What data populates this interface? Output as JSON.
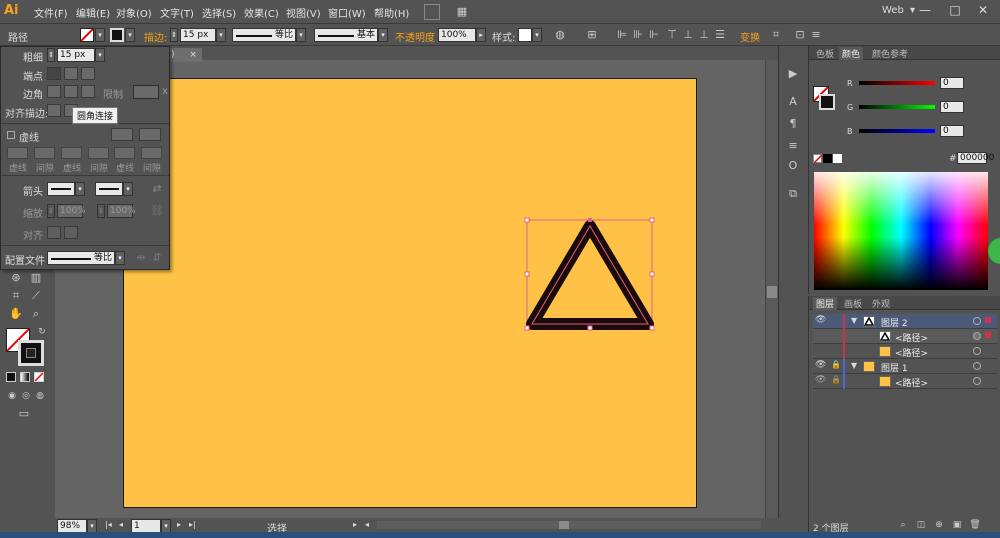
{
  "app": {
    "logo": "Ai",
    "workspace": "Web",
    "win_min": "—",
    "win_max": "□",
    "win_close": "✕"
  },
  "menu": [
    "文件(F)",
    "编辑(E)",
    "对象(O)",
    "文字(T)",
    "选择(S)",
    "效果(C)",
    "视图(V)",
    "窗口(W)",
    "帮助(H)"
  ],
  "control": {
    "object_type": "路径",
    "stroke_label": "描边:",
    "stroke_weight": "15 px",
    "variable_width": "等比",
    "brush": "基本",
    "opacity_label": "不透明度",
    "opacity_value": "100%",
    "style_label": "样式:",
    "transform_label": "变换"
  },
  "doc_tab": {
    "label": "览)",
    "close": "×"
  },
  "stroke_panel": {
    "weight_label": "粗细",
    "weight_value": "15 px",
    "cap_label": "端点",
    "corner_label": "边角",
    "limit_label": "限制",
    "align_label": "对齐描边:",
    "tooltip": "圆角连接",
    "dashed_label": "虚线",
    "dash_labels": [
      "虚线",
      "间隙",
      "虚线",
      "间隙",
      "虚线",
      "间隙"
    ],
    "arrow_label": "箭头",
    "scale_label": "缩放",
    "scale_values": [
      "100%",
      "100%"
    ],
    "align_label2": "对齐",
    "profile_label": "配置文件",
    "profile_value": "等比"
  },
  "color_panel": {
    "tabs": [
      "色板",
      "颜色",
      "颜色参考"
    ],
    "active_tab": "颜色",
    "r_label": "R",
    "g_label": "G",
    "b_label": "B",
    "r_value": "0",
    "g_value": "0",
    "b_value": "0",
    "hex_label": "#",
    "hex_value": "000000"
  },
  "layers_panel": {
    "tabs": [
      "图层",
      "画板",
      "外观"
    ],
    "active_tab": "图层",
    "rows": [
      {
        "name": "图层 2",
        "level": 0
      },
      {
        "name": "<路径>",
        "level": 1
      },
      {
        "name": "<路径>",
        "level": 1
      },
      {
        "name": "图层 1",
        "level": 0
      },
      {
        "name": "<路径>",
        "level": 1
      }
    ],
    "footer": "2 个图层"
  },
  "status": {
    "zoom": "98%",
    "artboard_num": "1",
    "mode": "选择"
  },
  "colors": {
    "artboard": "#ffc246",
    "accent": "#f7a21b",
    "stroke": "#1a0a0a",
    "selection": "#e0608a"
  }
}
